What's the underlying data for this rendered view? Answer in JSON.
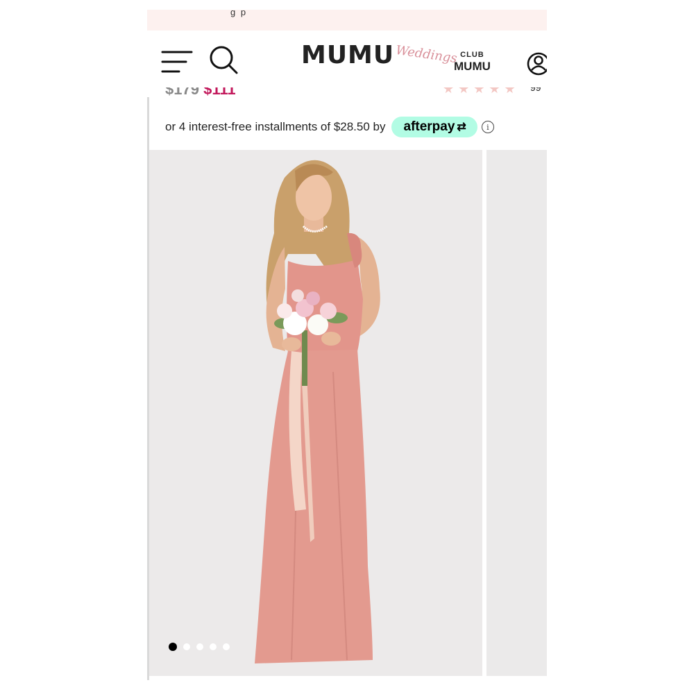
{
  "promo": {
    "text": "g p"
  },
  "header": {
    "brand": "MUMU",
    "brand_sub": "Weddings",
    "club_label": "CLUB",
    "club_brand": "MUMU"
  },
  "product": {
    "original_price": "$179",
    "sale_price": "$111",
    "rating_stars": "★★★★★",
    "review_count": "99"
  },
  "installments": {
    "text": "or 4 interest-free installments of $28.50 by",
    "provider": "afterpay",
    "info_glyph": "i"
  },
  "gallery": {
    "image_count": 5,
    "active_index": 0
  },
  "icons": {
    "menu": "menu-icon",
    "search": "search-icon",
    "account": "account-icon",
    "info": "info-icon"
  },
  "colors": {
    "promo_bg": "#fdf1ef",
    "afterpay_mint": "#b2fce4",
    "sale_price": "#c2185b",
    "dress": "#e2958b",
    "weddings_script": "#d9909a"
  }
}
